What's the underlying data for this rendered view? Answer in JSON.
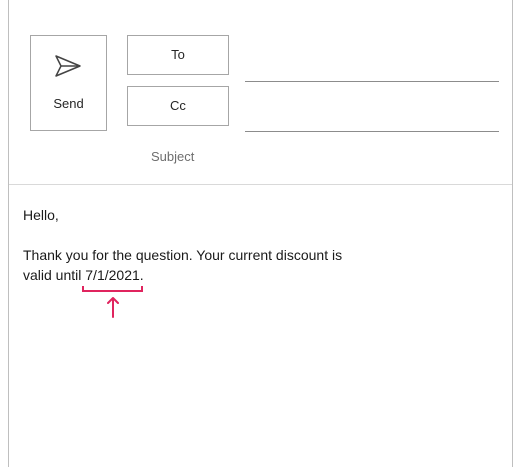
{
  "compose": {
    "send_label": "Send",
    "to_label": "To",
    "cc_label": "Cc",
    "subject_label": "Subject",
    "to_value": "",
    "cc_value": ""
  },
  "message": {
    "greeting": "Hello,",
    "line1": "Thank you for the question. Your current discount is",
    "line2_prefix": "valid until ",
    "highlighted_date": "7/1/2021",
    "line2_suffix": "."
  },
  "colors": {
    "annotation": "#e0245e",
    "border": "#a6a6a6"
  },
  "icons": {
    "send": "send-icon",
    "annotation_arrow": "arrow-up-icon"
  }
}
